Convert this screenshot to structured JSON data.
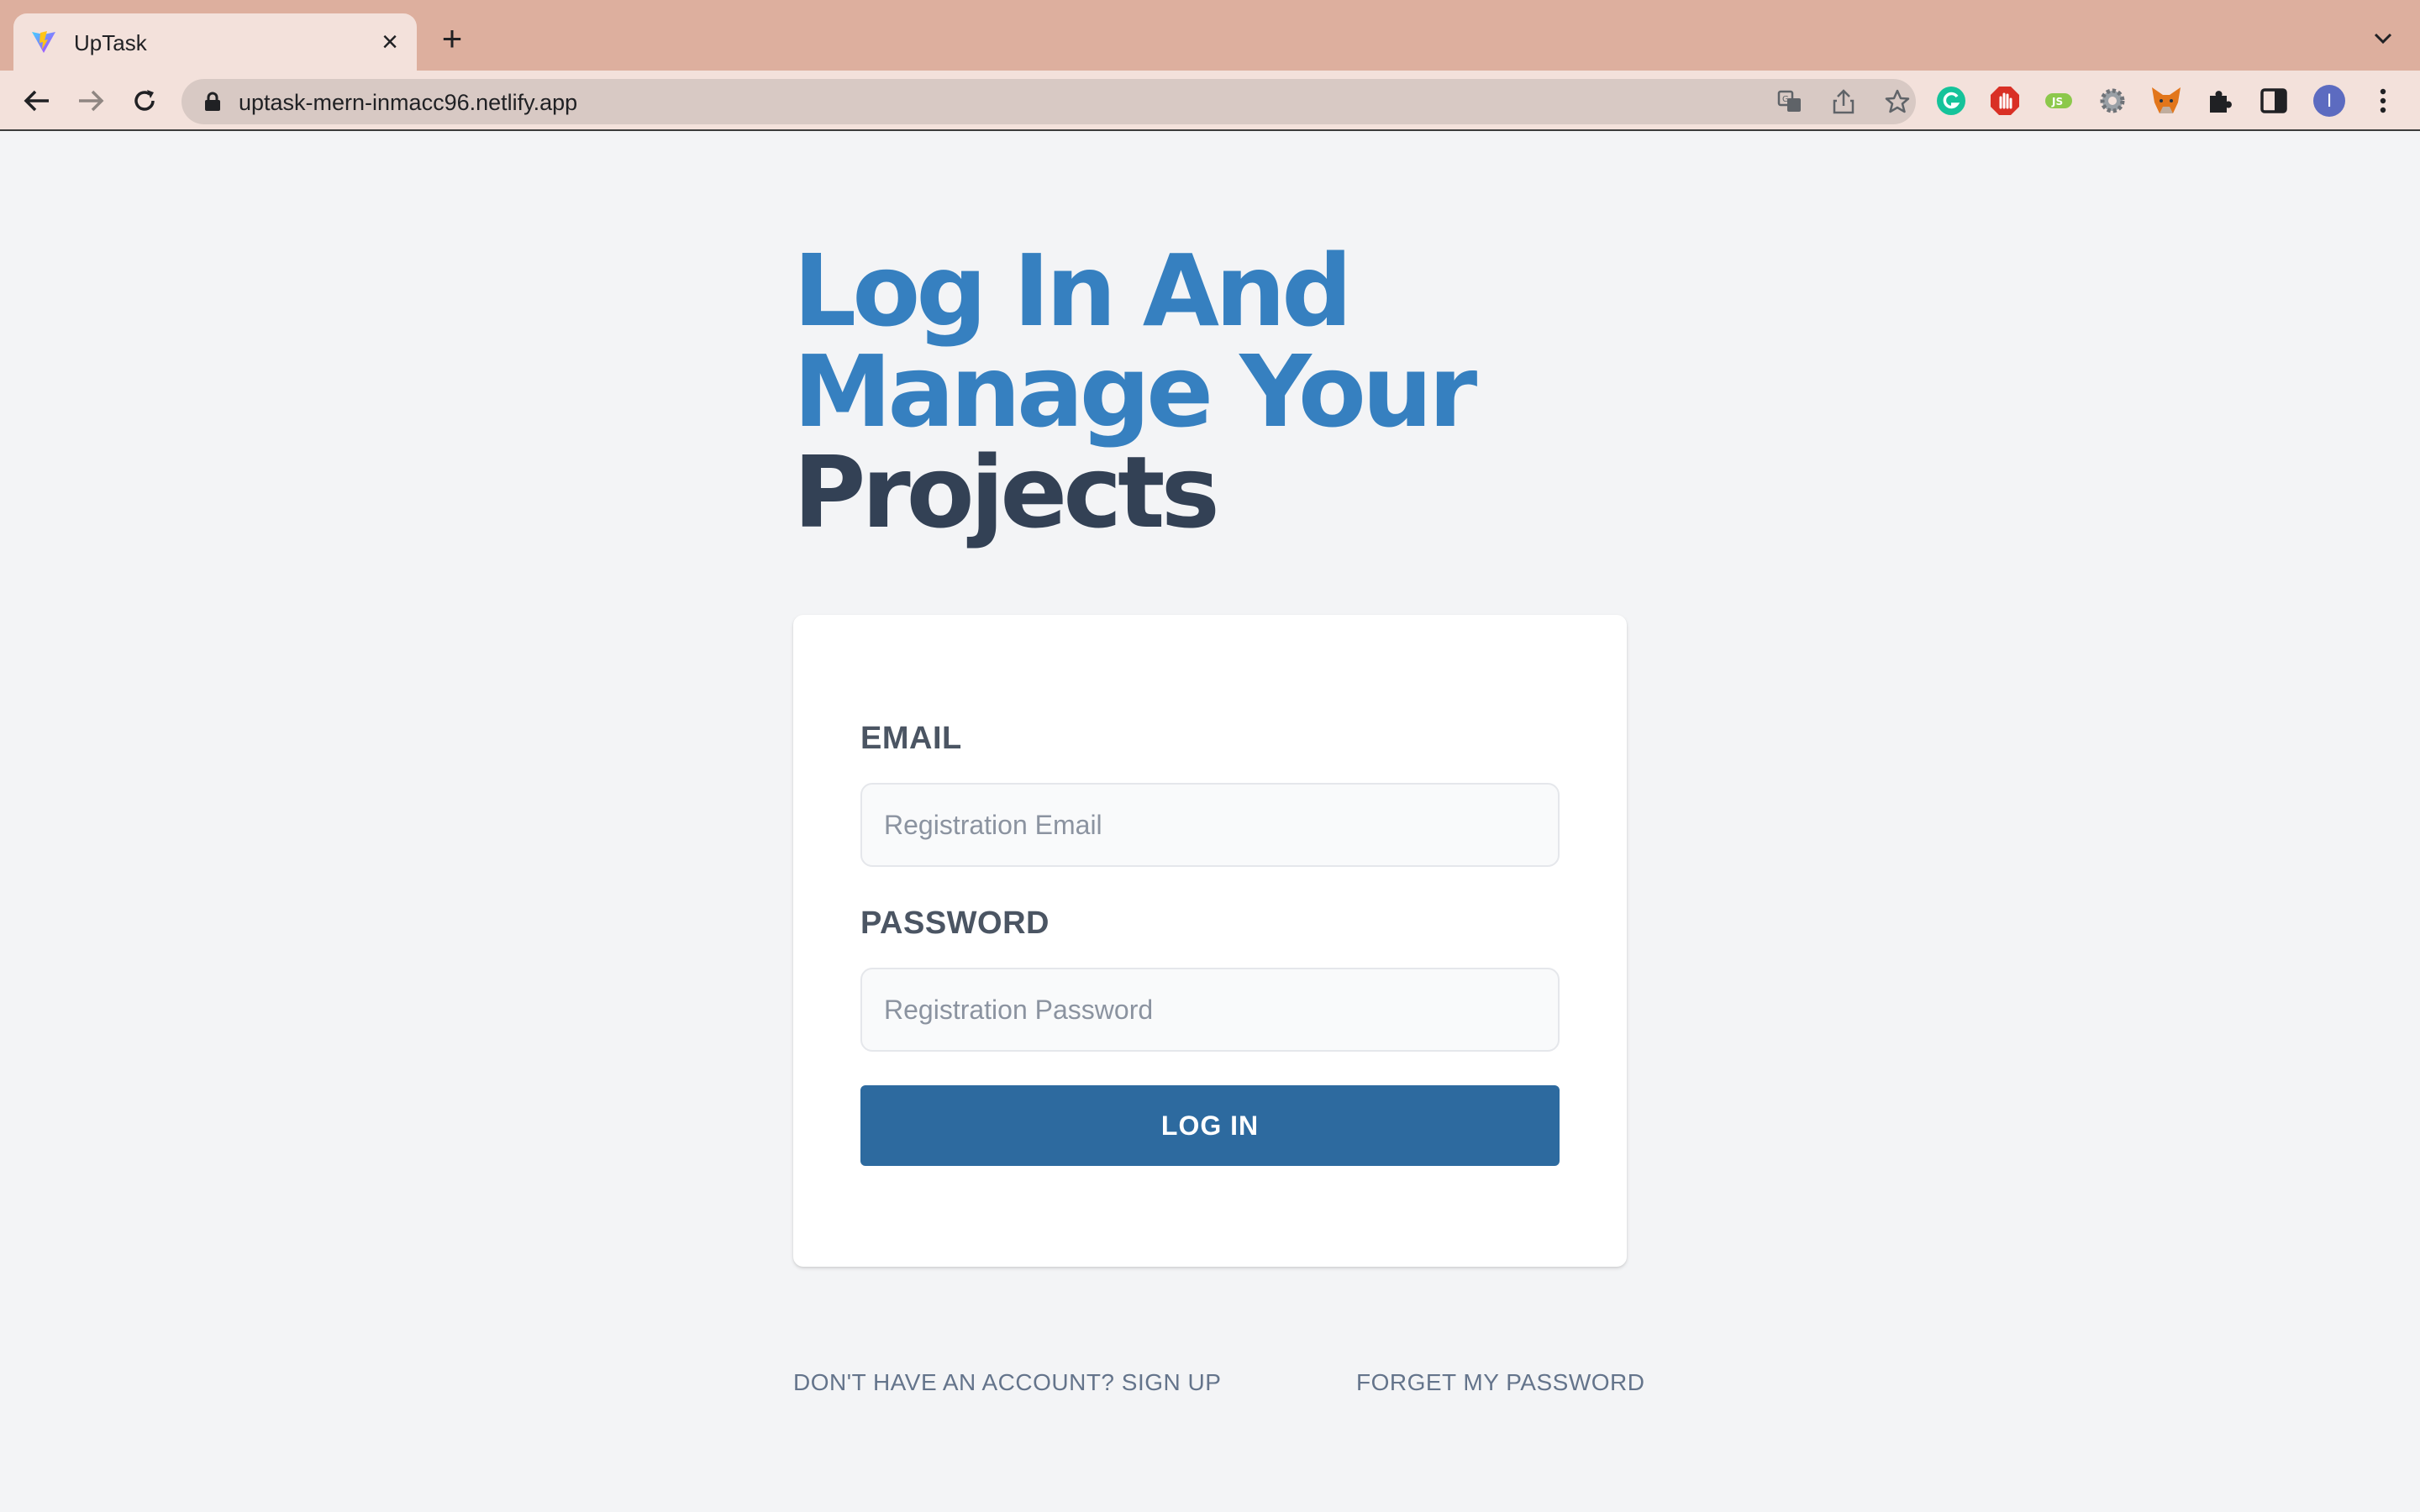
{
  "browser": {
    "tab_title": "UpTask",
    "url": "uptask-mern-inmacc96.netlify.app",
    "profile_initial": "I"
  },
  "page": {
    "headline_line1": "Log In And",
    "headline_line2": "Manage Your",
    "headline_line3": "Projects",
    "email_label": "EMAIL",
    "email_placeholder": "Registration Email",
    "password_label": "PASSWORD",
    "password_placeholder": "Registration Password",
    "login_button": "LOG IN",
    "signup_link": "DON'T HAVE AN ACCOUNT? SIGN UP",
    "forgot_link": "FORGET MY PASSWORD"
  },
  "colors": {
    "accent_blue": "#3680c0",
    "heading_dark": "#334155",
    "button_blue": "#2d6a9f",
    "page_bg": "#f3f4f6"
  }
}
